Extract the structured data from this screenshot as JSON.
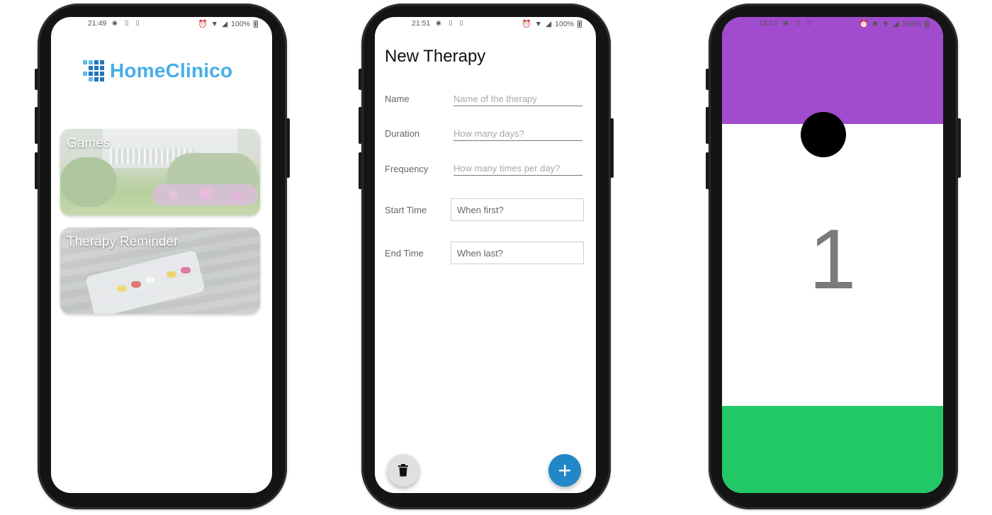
{
  "colors": {
    "logo_text": "#45aeea",
    "logo_dark": "#1f77bc",
    "fab_add": "#2187c7",
    "fab_delete": "#e0e0e0",
    "game_top": "#a14bcf",
    "game_bottom": "#22c865",
    "game_ball": "#000000"
  },
  "screen1": {
    "status": {
      "time": "21:49",
      "battery": "100%"
    },
    "logo_text": "HomeClinico",
    "cards": [
      {
        "label": "Games"
      },
      {
        "label": "Therapy Reminder"
      }
    ]
  },
  "screen2": {
    "status": {
      "time": "21:51",
      "battery": "100%"
    },
    "title": "New Therapy",
    "fields": {
      "name": {
        "label": "Name",
        "placeholder": "Name of the therapy"
      },
      "duration": {
        "label": "Duration",
        "placeholder": "How many days?"
      },
      "frequency": {
        "label": "Frequency",
        "placeholder": "How many times per day?"
      },
      "start_time": {
        "label": "Start Time",
        "placeholder": "When first?"
      },
      "end_time": {
        "label": "End Time",
        "placeholder": "When last?"
      }
    },
    "icons": {
      "delete": "trash-icon",
      "add": "plus-icon"
    }
  },
  "screen3": {
    "status": {
      "time": "12:14",
      "battery": "100%"
    },
    "counter": "1"
  }
}
